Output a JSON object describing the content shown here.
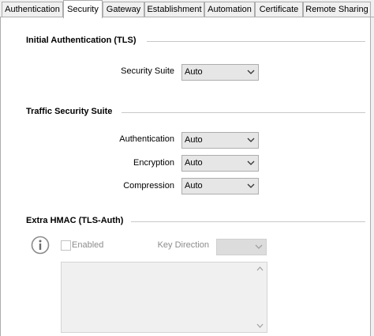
{
  "tabs": [
    {
      "label": "Authentication",
      "active": false
    },
    {
      "label": "Security",
      "active": true
    },
    {
      "label": "Gateway",
      "active": false
    },
    {
      "label": "Establishment",
      "active": false
    },
    {
      "label": "Automation",
      "active": false
    },
    {
      "label": "Certificate",
      "active": false
    },
    {
      "label": "Remote Sharing",
      "active": false
    }
  ],
  "initial_auth": {
    "title": "Initial Authentication (TLS)",
    "security_suite": {
      "label": "Security Suite",
      "value": "Auto"
    }
  },
  "traffic": {
    "title": "Traffic Security Suite",
    "authentication": {
      "label": "Authentication",
      "value": "Auto"
    },
    "encryption": {
      "label": "Encryption",
      "value": "Auto"
    },
    "compression": {
      "label": "Compression",
      "value": "Auto"
    }
  },
  "hmac": {
    "title": "Extra HMAC (TLS-Auth)",
    "enabled_label": "Enabled",
    "enabled_checked": false,
    "key_direction_label": "Key Direction",
    "key_direction_value": "",
    "key_text": ""
  },
  "icons": {
    "info": "info-circle-icon",
    "dropdown": "chevron-down-icon",
    "scroll_up": "scroll-up-arrow-icon",
    "scroll_down": "scroll-down-arrow-icon"
  },
  "colors": {
    "panel_bg": "#ffffff",
    "window_bg": "#f0f0f0",
    "border": "#adadad",
    "disabled_text": "#8c8c8c"
  }
}
